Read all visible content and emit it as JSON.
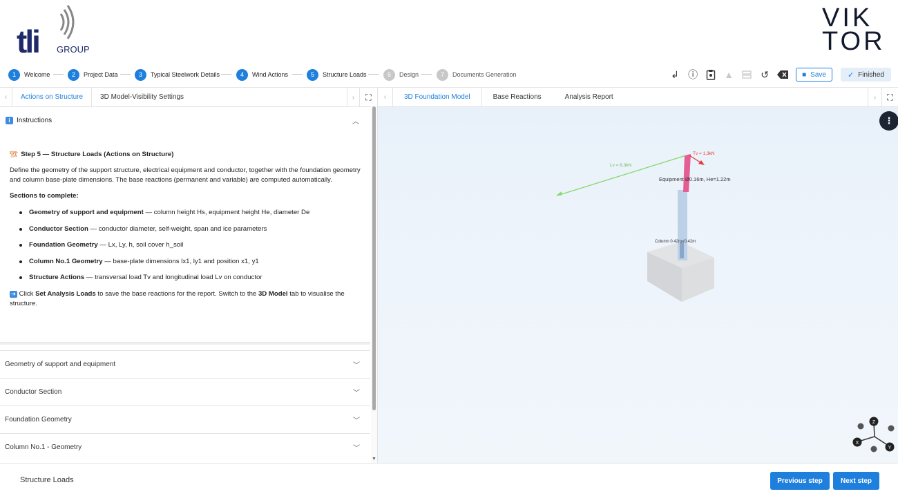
{
  "header": {
    "brand_left": "tli",
    "brand_left_sub": "GROUP",
    "brand_right_line1": "VIK",
    "brand_right_line2": "TOR"
  },
  "steps": [
    {
      "num": "1",
      "label": "Welcome",
      "state": "done"
    },
    {
      "num": "2",
      "label": "Project Data",
      "state": "done"
    },
    {
      "num": "3",
      "label": "Typical Steelwork Details",
      "state": "done"
    },
    {
      "num": "4",
      "label": "Wind Actions",
      "state": "done"
    },
    {
      "num": "5",
      "label": "Structure Loads",
      "state": "active"
    },
    {
      "num": "6",
      "label": "Design",
      "state": "future"
    },
    {
      "num": "7",
      "label": "Documents Generation",
      "state": "future"
    }
  ],
  "toolbar": {
    "icons": [
      "enter-icon",
      "info-icon",
      "clipboard-icon",
      "warning-icon",
      "storage-icon",
      "history-icon",
      "clear-icon"
    ],
    "save_label": "Save",
    "finished_label": "Finished"
  },
  "left_tabs": [
    {
      "label": "Actions on Structure",
      "active": true
    },
    {
      "label": "3D Model-Visibility Settings",
      "active": false
    }
  ],
  "instructions": {
    "header": "Instructions",
    "heading": "Step 5 — Structure Loads (Actions on Structure)",
    "intro": "Define the geometry of the support structure, electrical equipment and conductor, together with the foundation geometry and column base-plate dimensions. The base reactions (permanent and variable) are computed automatically.",
    "sections_title": "Sections to complete:",
    "items": [
      {
        "bold": "Geometry of support and equipment",
        "text": " — column height Hs, equipment height He, diameter De"
      },
      {
        "bold": "Conductor Section",
        "text": " — conductor diameter, self-weight, span and ice parameters"
      },
      {
        "bold": "Foundation Geometry",
        "text": " — Lx, Ly, h, soil cover h_soil"
      },
      {
        "bold": "Column No.1 Geometry",
        "text": " — base-plate dimensions lx1, ly1 and position x1, y1"
      },
      {
        "bold": "Structure Actions",
        "text": " — transversal load Tv and longitudinal load Lv on conductor"
      }
    ],
    "footer_pre": " Click ",
    "footer_b1": "Set Analysis Loads",
    "footer_mid": " to save the base reactions for the report. Switch to the ",
    "footer_b2": "3D Model",
    "footer_post": " tab to visualise the structure."
  },
  "accordions": [
    "Geometry of support and equipment",
    "Conductor Section",
    "Foundation Geometry",
    "Column No.1 - Geometry"
  ],
  "right_tabs": [
    {
      "label": "3D Foundation Model",
      "active": true
    },
    {
      "label": "Base Reactions",
      "active": false
    },
    {
      "label": "Analysis Report",
      "active": false
    }
  ],
  "model": {
    "tv_label": "Tv = 1,3kN",
    "lv_label": "Lv = 8,3kN",
    "equipment_label": "Equipment Ø0.16m, He=1.22m",
    "column_label": "Column 0.42m×0.42m",
    "axes": {
      "x": "X",
      "y": "Y",
      "z": "Z"
    },
    "colors": {
      "lv_arrow": "#7ed957",
      "tv_arrow": "#e53935",
      "equipment": "#e34a86",
      "column": "#b9cde6",
      "foundation": "#d9dbde"
    }
  },
  "footer": {
    "title": "Structure Loads",
    "prev_label": "Previous step",
    "next_label": "Next step"
  }
}
